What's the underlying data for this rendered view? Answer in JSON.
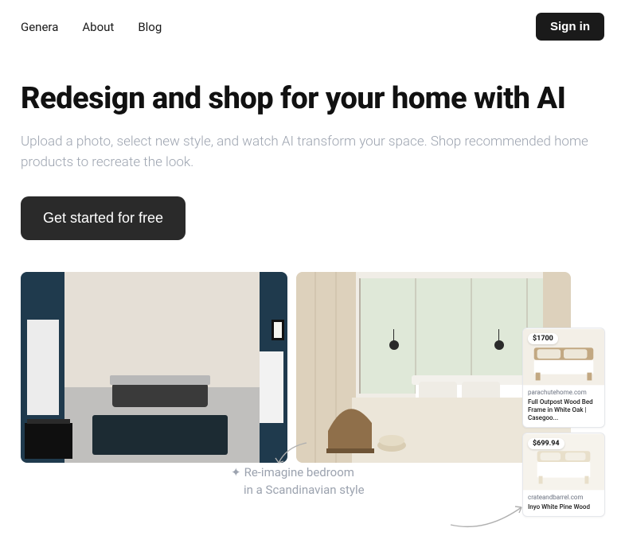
{
  "nav": {
    "brand": "Genera",
    "links": [
      "About",
      "Blog"
    ],
    "signIn": "Sign in"
  },
  "hero": {
    "heading": "Redesign and shop for your home with AI",
    "sub": "Upload a photo, select new style, and watch AI transform your space. Shop recommended home products to recreate the look.",
    "cta": "Get started for free"
  },
  "caption": {
    "line1": "Re-imagine bedroom",
    "line2": "in a Scandinavian style"
  },
  "products": [
    {
      "price": "$1700",
      "store": "parachutehome.com",
      "title": "Full Outpost Wood Bed Frame in White Oak | Casegoo..."
    },
    {
      "price": "$699.94",
      "store": "crateandbarrel.com",
      "title": "Inyo White Pine Wood"
    }
  ]
}
